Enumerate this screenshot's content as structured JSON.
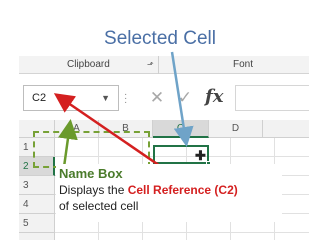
{
  "title": "Selected Cell",
  "ribbon": {
    "groups": [
      "Clipboard",
      "Font"
    ],
    "launcher_icon": "dialog-launcher-icon"
  },
  "formula_bar": {
    "name_box_value": "C2",
    "cancel_symbol": "✕",
    "enter_symbol": "✓",
    "function_label": "fx",
    "formula_value": ""
  },
  "grid": {
    "columns": [
      "A",
      "B",
      "C",
      "D"
    ],
    "rows": [
      "1",
      "2",
      "3",
      "4",
      "5"
    ],
    "selected_column": "C",
    "selected_row": "2"
  },
  "annotation": {
    "heading": "Name Box",
    "line1_prefix": "Displays the ",
    "line1_highlight": "Cell Reference (C2)",
    "line2": "of selected cell"
  },
  "colors": {
    "title": "#4a6fa5",
    "highlight_red": "#d42020",
    "name_box_green": "#4a7b2b",
    "dashed_border": "#77a136",
    "selection_green": "#217346",
    "arrow_blue": "#6fa3c8",
    "arrow_red": "#d42020",
    "arrow_green": "#6a9a2c"
  }
}
